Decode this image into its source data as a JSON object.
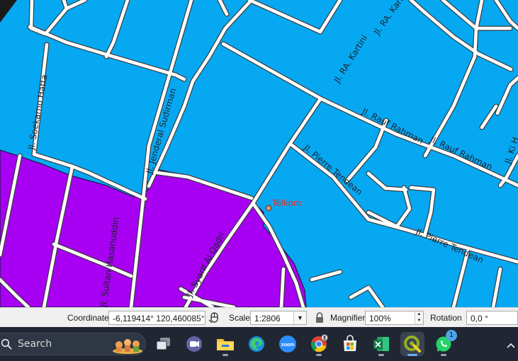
{
  "map": {
    "road_labels": [
      "Jl. Soekarno Hatta",
      "Jl. Jenderal Sudirman",
      "Jl. RA. Kartini",
      "Jl. RA. Kartini",
      "Jl. Rauf Rahman",
      "Jl. Rauf Rahman",
      "Jl. Pierre Tendean",
      "Jl. Pierre Tendean",
      "Jl. Sultan Hasanuddin",
      "Jl. Syarif Al Qadri",
      "Jl. Ki H"
    ],
    "poi": {
      "label": "Telkom"
    },
    "colors": {
      "region_a": "#06a8f2",
      "region_b": "#a700f2",
      "road": "#ffffff",
      "poi": "#d8342c"
    }
  },
  "statusbar": {
    "coordinate_label": "Coordinate",
    "coordinate_value": "-6,119414°  120,460085°",
    "scale_label": "Scale",
    "scale_value": "1:2806",
    "magnifier_label": "Magnifier",
    "magnifier_value": "100%",
    "rotation_label": "Rotation",
    "rotation_value": "0,0 °",
    "icons": [
      "mouse-icon",
      "lock-icon"
    ]
  },
  "taskbar": {
    "search_placeholder": "Search",
    "zoom_label": "zoom",
    "whatsapp_badge": "1",
    "apps": [
      "task-view",
      "teams",
      "file-explorer",
      "edge",
      "zoom",
      "chrome",
      "microsoft-store",
      "excel",
      "qgis",
      "whatsapp"
    ],
    "tray_icon": "chevron-up-icon"
  }
}
